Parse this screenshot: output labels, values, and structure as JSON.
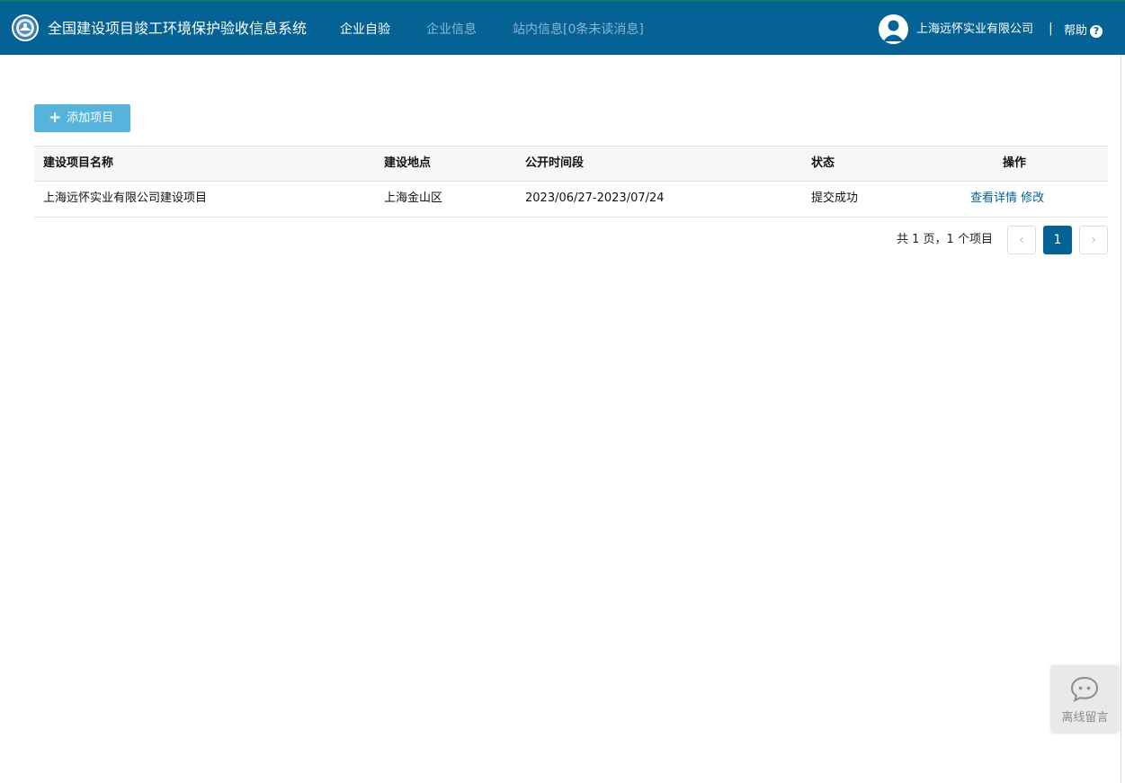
{
  "header": {
    "app_title": "全国建设项目竣工环境保护验收信息系统",
    "nav": [
      {
        "label": "企业自验",
        "active": true
      },
      {
        "label": "企业信息",
        "active": false
      },
      {
        "label": "站内信息[0条未读消息]",
        "active": false
      }
    ],
    "company_name": "上海远怀实业有限公司",
    "separator": "|",
    "help_label": "帮助",
    "help_icon_glyph": "?",
    "logo_icon": "emblem-icon",
    "avatar_icon": "user-avatar-icon"
  },
  "toolbar": {
    "add_label": "添加项目",
    "add_icon_glyph": "+"
  },
  "table": {
    "columns": [
      "建设项目名称",
      "建设地点",
      "公开时间段",
      "状态",
      "操作"
    ],
    "rows": [
      {
        "name": "上海远怀实业有限公司建设项目",
        "location": "上海金山区",
        "period": "2023/06/27-2023/07/24",
        "status": "提交成功",
        "actions": [
          "查看详情",
          "修改"
        ]
      }
    ]
  },
  "pagination": {
    "summary": "共 1 页，1 个项目",
    "prev_glyph": "‹",
    "next_glyph": "›",
    "current_page": "1"
  },
  "chat_widget": {
    "label": "离线留言",
    "icon": "chat-bubble-icon"
  },
  "colors": {
    "header_bg": "#046294",
    "accent_button": "#56b3dc",
    "link": "#046294",
    "current_page": "#046294"
  }
}
